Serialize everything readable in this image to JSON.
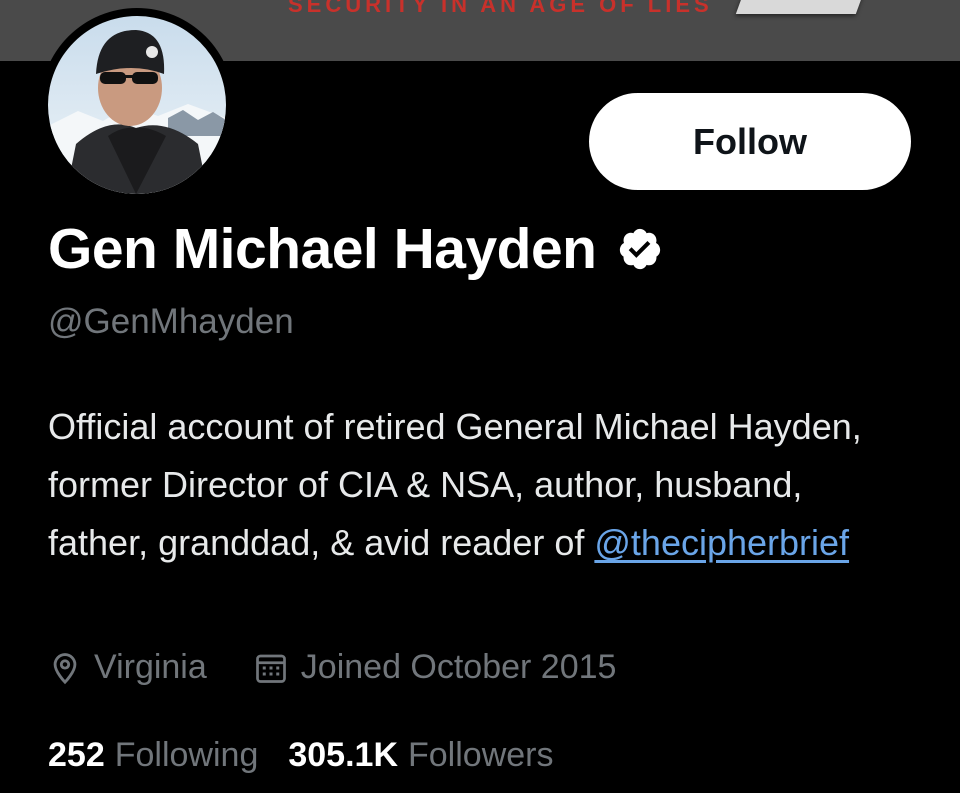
{
  "banner": {
    "text": "SECURITY IN AN AGE OF LIES"
  },
  "profile": {
    "name": "Gen Michael Hayden",
    "handle": "@GenMhayden",
    "bio_text": "Official account of retired General Michael Hayden, former Director of CIA & NSA, author, husband, father, granddad, & avid reader of ",
    "bio_link": "@thecipherbrief",
    "location": "Virginia",
    "joined": "Joined October 2015"
  },
  "actions": {
    "follow_label": "Follow"
  },
  "stats": {
    "following_count": "252",
    "following_label": "Following",
    "followers_count": "305.1K",
    "followers_label": "Followers"
  },
  "icons": {
    "verified": "verified-badge-icon",
    "location": "location-pin-icon",
    "calendar": "calendar-icon"
  },
  "colors": {
    "background": "#000000",
    "link": "#6aa5e8",
    "secondary_text": "#71767b",
    "banner_text": "#c8312b"
  }
}
